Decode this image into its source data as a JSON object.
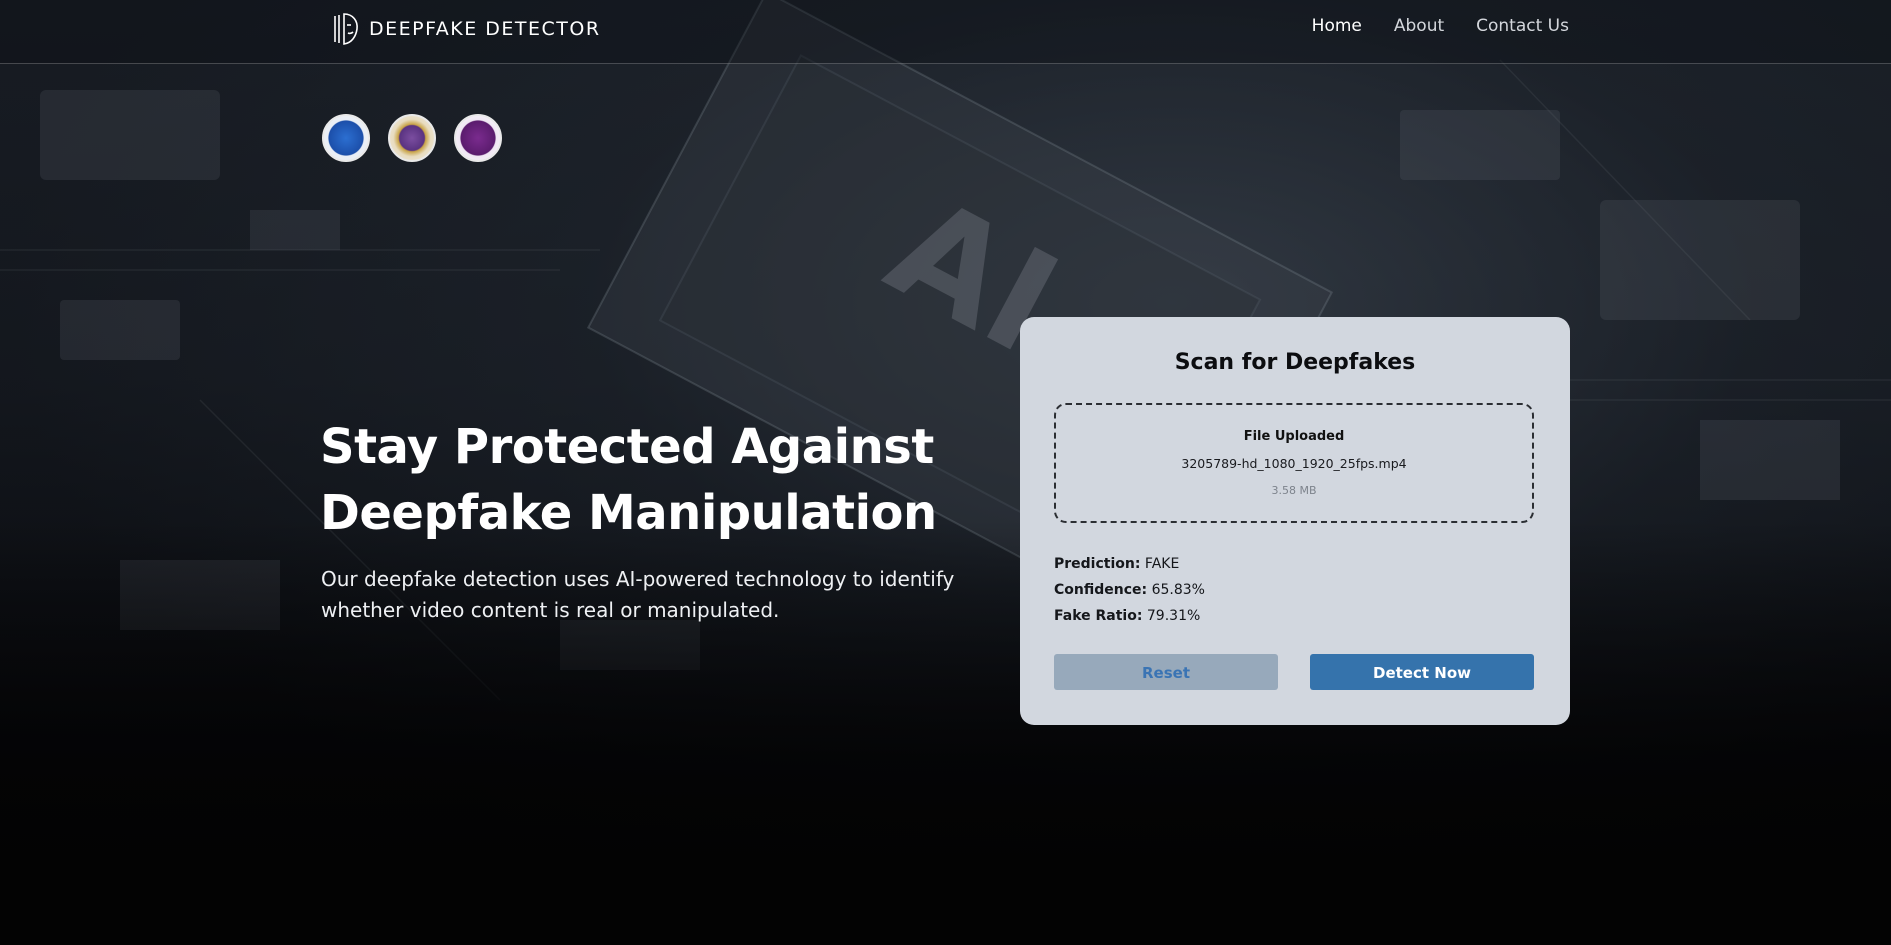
{
  "brand": {
    "name": "DEEPFAKE DETECTOR",
    "icon": "face-outline-icon"
  },
  "nav": {
    "items": [
      {
        "label": "Home",
        "active": true
      },
      {
        "label": "About",
        "active": false
      },
      {
        "label": "Contact Us",
        "active": false
      }
    ]
  },
  "logos": [
    {
      "name": "university-seal-blue-icon"
    },
    {
      "name": "college-seal-gold-icon"
    },
    {
      "name": "engineering-seal-purple-icon"
    }
  ],
  "hero": {
    "title_line1": "Stay Protected Against",
    "title_line2": "Deepfake Manipulation",
    "subtitle_line1": "Our deepfake detection uses AI-powered technology to identify",
    "subtitle_line2": "whether video content is real or manipulated."
  },
  "card": {
    "title": "Scan for Deepfakes",
    "upload": {
      "label": "File Uploaded",
      "file_name": "3205789-hd_1080_1920_25fps.mp4",
      "file_size": "3.58 MB"
    },
    "results": {
      "prediction_label": "Prediction:",
      "prediction_value": "FAKE",
      "confidence_label": "Confidence:",
      "confidence_value": "65.83%",
      "ratio_label": "Fake Ratio:",
      "ratio_value": "79.31%"
    },
    "reset_label": "Reset",
    "detect_label": "Detect Now"
  },
  "colors": {
    "card_bg": "#d2d7df",
    "detect_button": "#3573ac",
    "reset_button": "#97a9bb",
    "page_bg": "#07090c"
  }
}
